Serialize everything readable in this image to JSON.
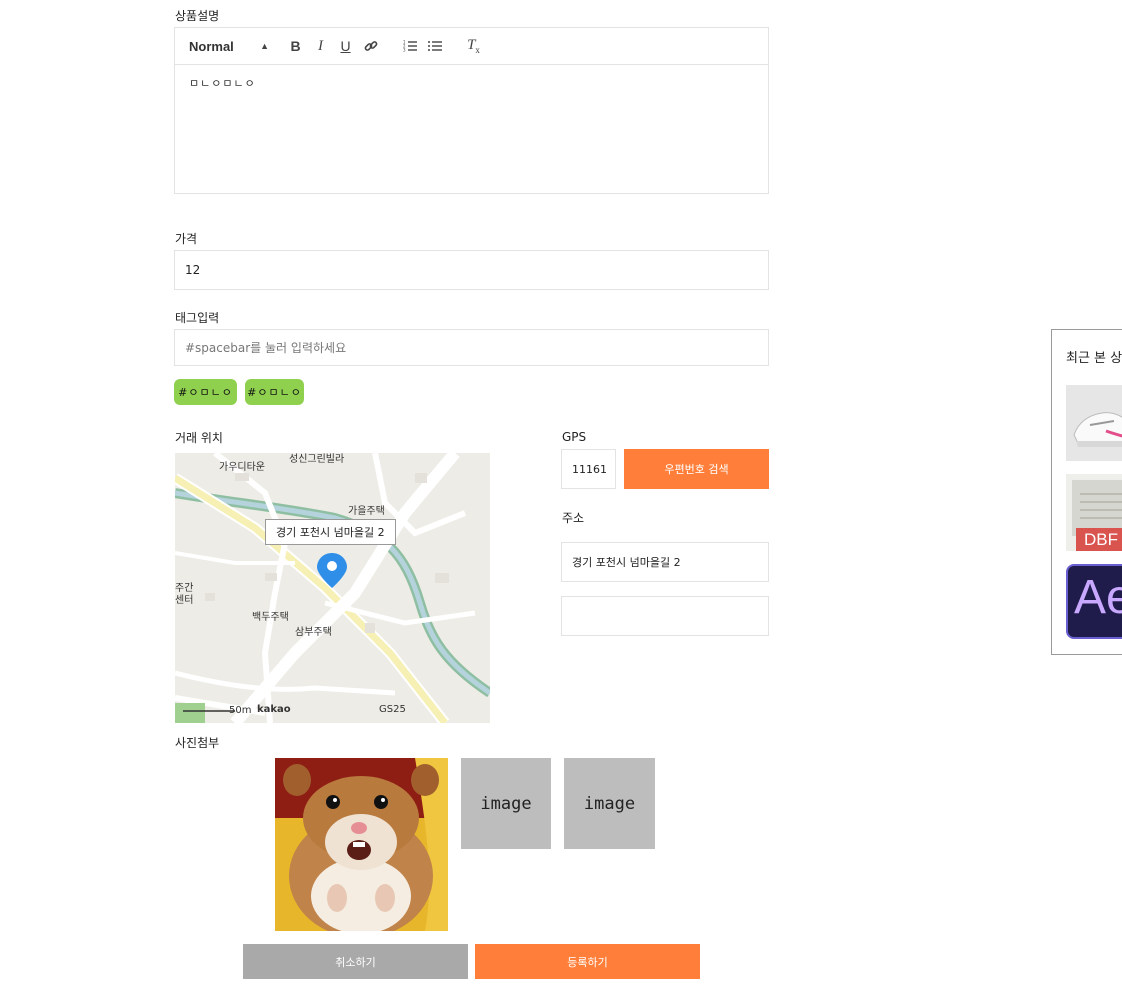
{
  "description": {
    "label": "상품설명",
    "toolbar": {
      "format": "Normal"
    },
    "content": "ㅁㄴㅇㅁㄴㅇ"
  },
  "price": {
    "label": "가격",
    "value": "12"
  },
  "tags": {
    "label": "태그입력",
    "placeholder": "#spacebar를 눌러 입력하세요",
    "items": [
      "#ㅇㅁㄴㅇ",
      "#ㅇㅁㄴㅇ"
    ]
  },
  "location": {
    "label": "거래 위치",
    "map": {
      "tooltip": "경기 포천시 넘마을길 2",
      "places": [
        "가우디타운",
        "성신그린빌라",
        "백두주택",
        "삼부주택",
        "GS25",
        "주간",
        "센터",
        "가을주택"
      ],
      "scale": "50m",
      "brand": "kakao"
    }
  },
  "gps": {
    "label": "GPS",
    "zipcode": "11161",
    "search_button": "우편번호 검색",
    "address_label": "주소",
    "address": "경기 포천시 넘마을길 2",
    "address_detail": ""
  },
  "photos": {
    "label": "사진첨부",
    "placeholders": [
      "image",
      "image"
    ]
  },
  "actions": {
    "cancel": "취소하기",
    "submit": "등록하기"
  },
  "recent": {
    "title": "최근 본 상",
    "dbf_text": "DBF",
    "ae_text": "Ae"
  },
  "colors": {
    "accent": "#ff7f3a",
    "tag": "#8fd14f",
    "gray_button": "#a9a9a9"
  }
}
